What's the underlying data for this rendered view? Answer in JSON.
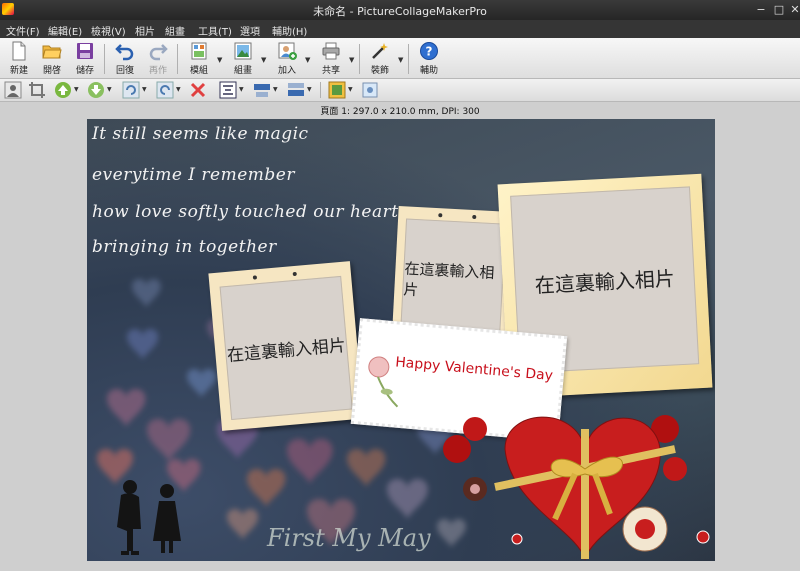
{
  "window": {
    "title": "未命名 - PictureCollageMakerPro",
    "minimize": "−",
    "maximize": "□",
    "close": "✕"
  },
  "menu": [
    "文件(F)",
    "編輯(E)",
    "檢視(V)",
    "相片",
    "組畫",
    "工具(T)",
    "選項",
    "輔助(H)"
  ],
  "toolbar": {
    "new": "新建",
    "open": "開啓",
    "save": "儲存",
    "undo": "回復",
    "redo": "再作",
    "template": "模組",
    "collage": "組畫",
    "add": "加入",
    "share": "共享",
    "decorate": "裝飾",
    "help": "輔助"
  },
  "toolbar2_icons": [
    "person-icon",
    "crop-icon",
    "move-up-icon",
    "move-down-icon",
    "rotate-left-icon",
    "rotate-right-icon",
    "delete-icon",
    "align-center-icon",
    "align-top-icon",
    "align-bottom-icon",
    "frame-icon",
    "image-icon"
  ],
  "page_info": "頁面 1: 297.0 x 210.0 mm, DPI: 300",
  "canvas": {
    "poem": [
      "It still seems like magic",
      "everytime I remember",
      "how love softly touched our hearts",
      "bringing in together"
    ],
    "placeholder_text": "在這裏輸入相片",
    "card_text": "Happy Valentine's Day",
    "footer_text": "First My May"
  },
  "colors": {
    "card_text": "#c8101c",
    "heart": "#c81e1e",
    "bow": "#d8b040",
    "frame": "#f6e6c2"
  }
}
